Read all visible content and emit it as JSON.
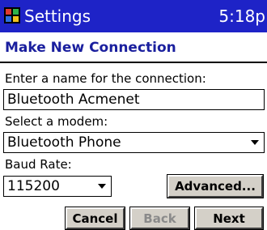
{
  "titlebar": {
    "title": "Settings",
    "time": "5:18p",
    "app_icon": "settings-flag-icon"
  },
  "header": {
    "title": "Make New Connection"
  },
  "form": {
    "name_label": "Enter a name for the connection:",
    "name_value": "Bluetooth Acmenet",
    "modem_label": "Select a modem:",
    "modem_value": "Bluetooth Phone",
    "baud_label": "Baud Rate:",
    "baud_value": "115200"
  },
  "buttons": {
    "advanced": "Advanced...",
    "cancel": "Cancel",
    "back": "Back",
    "next": "Next"
  },
  "colors": {
    "titlebar_bg": "#1e23c7",
    "header_text": "#1a1f9e",
    "button_face": "#d4d0c8"
  }
}
